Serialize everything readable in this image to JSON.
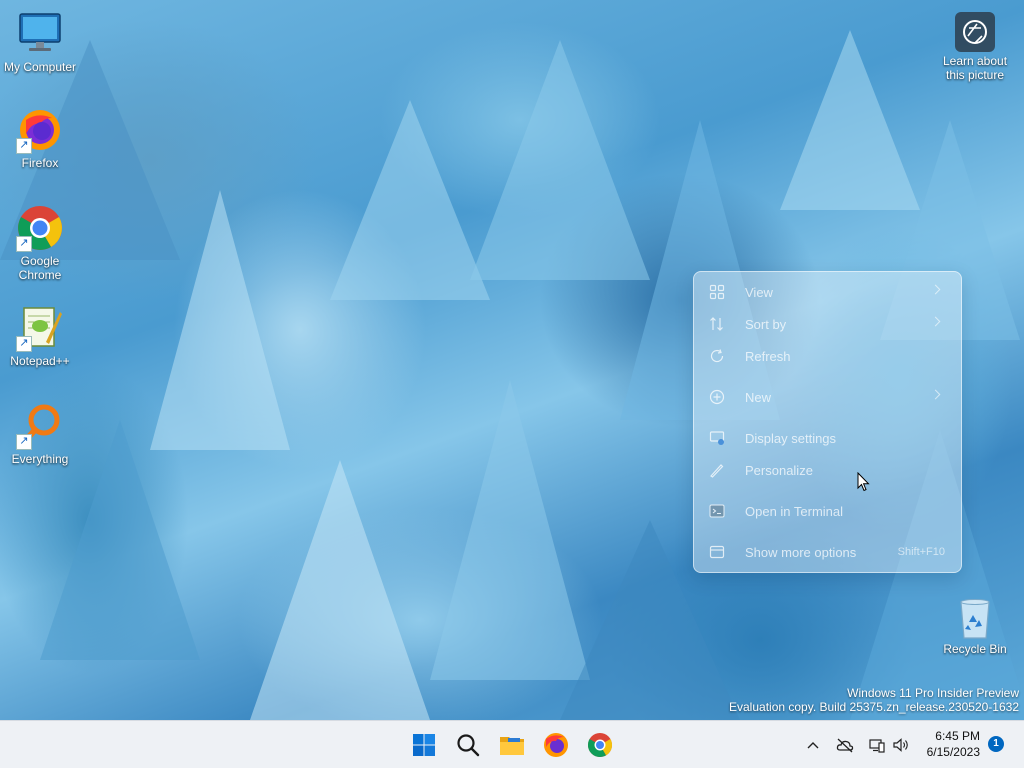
{
  "desktop": {
    "icons": [
      {
        "label": "My Computer",
        "icon": "monitor-icon"
      },
      {
        "label": "Firefox",
        "icon": "firefox-icon"
      },
      {
        "label": "Google Chrome",
        "icon": "chrome-icon"
      },
      {
        "label": "Notepad++",
        "icon": "notepad-plus-plus-icon"
      },
      {
        "label": "Everything",
        "icon": "everything-search-icon"
      },
      {
        "label": "Recycle Bin",
        "icon": "recycle-bin-icon"
      }
    ],
    "spotlight": {
      "label": "Learn about this picture",
      "icon": "camera-info-icon"
    },
    "watermark": {
      "line1": "Windows 11 Pro Insider Preview",
      "line2": "Evaluation copy. Build 25375.zn_release.230520-1632"
    }
  },
  "context_menu": {
    "items": [
      {
        "label": "View",
        "icon": "grid-icon",
        "submenu": true
      },
      {
        "label": "Sort by",
        "icon": "sort-icon",
        "submenu": true
      },
      {
        "label": "Refresh",
        "icon": "refresh-icon"
      },
      {
        "label": "New",
        "icon": "plus-circle-icon",
        "submenu": true
      },
      {
        "label": "Display settings",
        "icon": "display-icon"
      },
      {
        "label": "Personalize",
        "icon": "brush-icon"
      },
      {
        "label": "Open in Terminal",
        "icon": "terminal-icon"
      },
      {
        "label": "Show more options",
        "icon": "more-options-icon",
        "shortcut": "Shift+F10"
      }
    ]
  },
  "taskbar": {
    "apps": [
      {
        "name": "Start",
        "icon": "windows-start-icon"
      },
      {
        "name": "Search",
        "icon": "search-icon"
      },
      {
        "name": "File Explorer",
        "icon": "folder-icon"
      },
      {
        "name": "Firefox",
        "icon": "firefox-icon"
      },
      {
        "name": "Google Chrome",
        "icon": "chrome-icon"
      }
    ],
    "tray": {
      "icons": [
        "chevron-up-icon",
        "cloud-offline-icon",
        "network-icon",
        "volume-icon"
      ],
      "time": "6:45 PM",
      "date": "6/15/2023",
      "notification_count": "1"
    }
  }
}
